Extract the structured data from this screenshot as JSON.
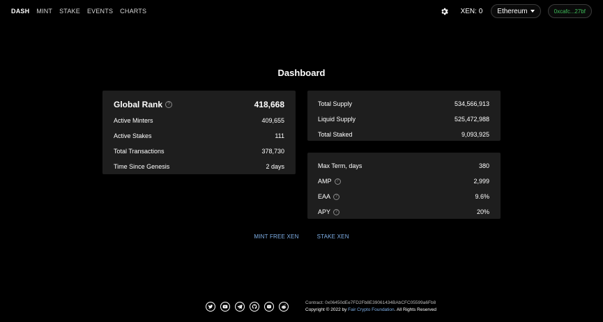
{
  "nav": {
    "links": [
      "DASH",
      "MINT",
      "STAKE",
      "EVENTS",
      "CHARTS"
    ],
    "icons": {
      "settings": "gear-icon"
    },
    "balance": "XEN: 0",
    "network": "Ethereum",
    "address": "0xcafc...27bf"
  },
  "title": "Dashboard",
  "rank_card": {
    "head_label": "Global Rank",
    "head_value": "418,668",
    "rows": [
      {
        "label": "Active Minters",
        "value": "409,655"
      },
      {
        "label": "Active Stakes",
        "value": "111"
      },
      {
        "label": "Total Transactions",
        "value": "378,730"
      },
      {
        "label": "Time Since Genesis",
        "value": "2 days"
      }
    ]
  },
  "supply_card": {
    "rows": [
      {
        "label": "Total Supply",
        "value": "534,566,913"
      },
      {
        "label": "Liquid Supply",
        "value": "525,472,988"
      },
      {
        "label": "Total Staked",
        "value": "9,093,925"
      }
    ]
  },
  "terms_card": {
    "rows": [
      {
        "label": "Max Term, days",
        "value": "380"
      },
      {
        "label": "AMP",
        "value": "2,999"
      },
      {
        "label": "EAA",
        "value": "9.6%"
      },
      {
        "label": "APY",
        "value": "20%"
      }
    ]
  },
  "help_glyph": "?",
  "actions": {
    "mint": "MINT FREE XEN",
    "stake": "STAKE XEN"
  },
  "footer": {
    "socials": [
      "twitter-icon",
      "youtube-icon",
      "telegram-icon",
      "github-icon",
      "discord-icon",
      "reddit-icon"
    ],
    "contract": "Contract: 0x06450dEe7FD2Fb8E39061434BAbCFC05599a6Fb8",
    "copyright_prefix": "Copyright © 2022 by",
    "copyright_link": "Fair Crypto Foundation",
    "copyright_suffix": ". All Rights Reserved"
  }
}
